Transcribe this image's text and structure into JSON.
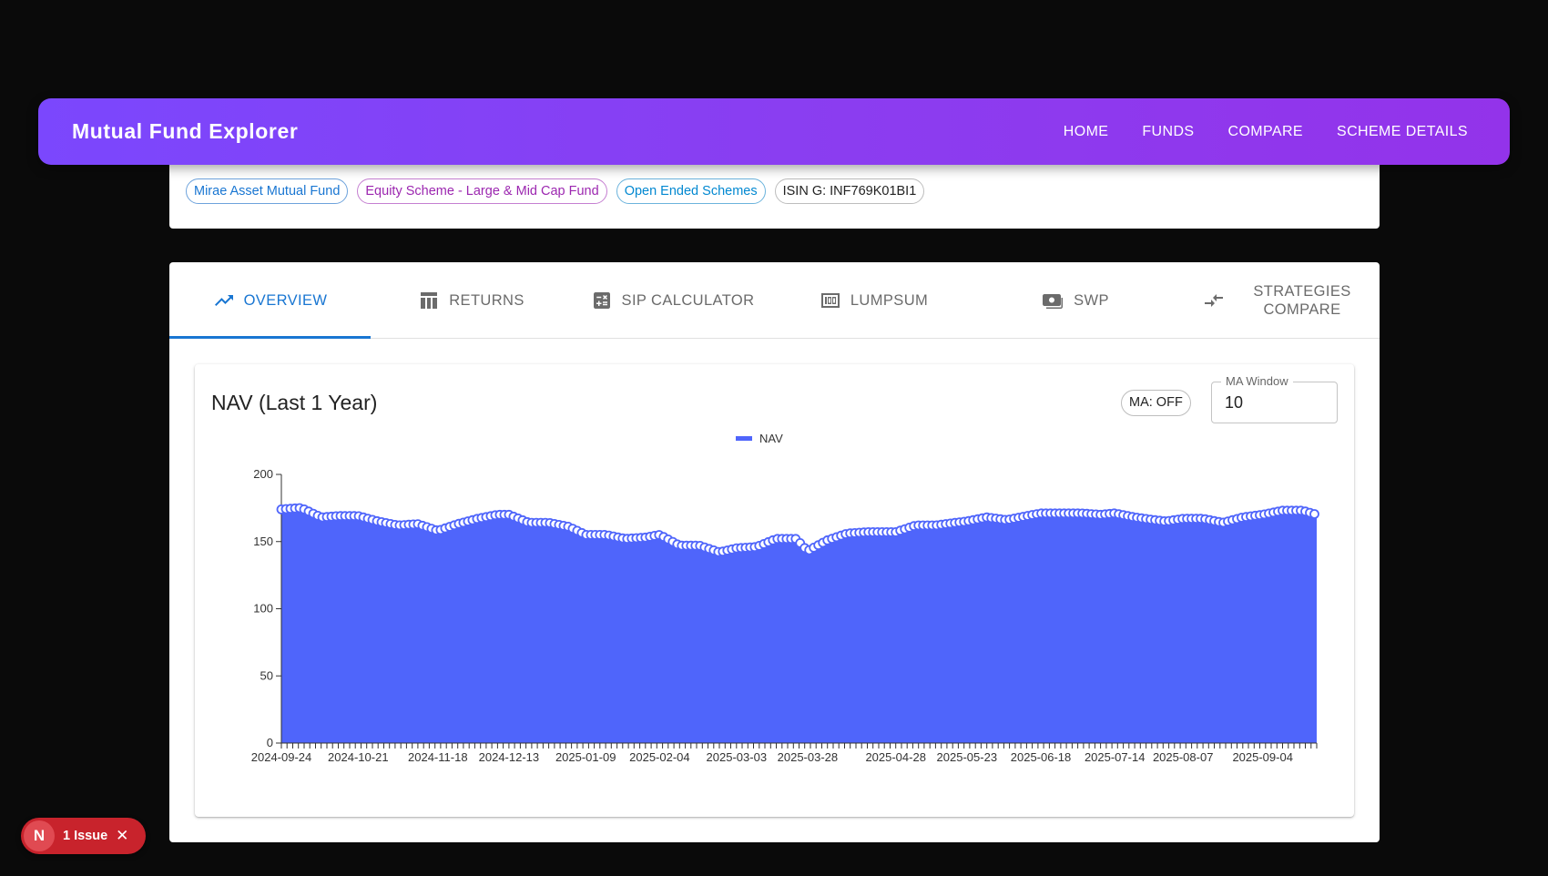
{
  "appbar": {
    "title": "Mutual Fund Explorer",
    "nav": [
      "HOME",
      "FUNDS",
      "COMPARE",
      "SCHEME DETAILS"
    ]
  },
  "chips": [
    {
      "label": "Mirae Asset Mutual Fund",
      "color": "#1976d2"
    },
    {
      "label": "Equity Scheme - Large & Mid Cap Fund",
      "color": "#9c27b0"
    },
    {
      "label": "Open Ended Schemes",
      "color": "#0288d1"
    },
    {
      "label": "ISIN G: INF769K01BI1",
      "color": "#222222"
    }
  ],
  "tabs": [
    {
      "label": "OVERVIEW",
      "icon": "trending-up-icon",
      "active": true
    },
    {
      "label": "RETURNS",
      "icon": "table-icon",
      "active": false
    },
    {
      "label": "SIP CALCULATOR",
      "icon": "calculator-icon",
      "active": false
    },
    {
      "label": "LUMPSUM",
      "icon": "lumpsum-icon",
      "active": false
    },
    {
      "label": "SWP",
      "icon": "payments-icon",
      "active": false
    },
    {
      "label": "STRATEGIES COMPARE",
      "icon": "compare-arrows-icon",
      "active": false
    }
  ],
  "chart_panel": {
    "title": "NAV (Last 1 Year)",
    "ma_toggle": "MA: OFF",
    "ma_window_label": "MA Window",
    "ma_window_value": "10"
  },
  "chart_data": {
    "type": "area",
    "series": [
      {
        "name": "NAV",
        "color": "#4f65fb"
      }
    ],
    "ylim": [
      0,
      200
    ],
    "yticks": [
      0,
      50,
      100,
      150,
      200
    ],
    "x_tick_labels": [
      "2024-09-24",
      "2024-10-21",
      "2024-11-18",
      "2024-12-13",
      "2025-01-09",
      "2025-02-04",
      "2025-03-03",
      "2025-03-28",
      "2025-04-28",
      "2025-05-23",
      "2025-06-18",
      "2025-07-14",
      "2025-08-07",
      "2025-09-04"
    ],
    "nav_points": [
      {
        "date": "2024-09-24",
        "nav": 174
      },
      {
        "date": "2024-10-01",
        "nav": 175
      },
      {
        "date": "2024-10-08",
        "nav": 168
      },
      {
        "date": "2024-10-14",
        "nav": 169
      },
      {
        "date": "2024-10-21",
        "nav": 169
      },
      {
        "date": "2024-10-28",
        "nav": 165
      },
      {
        "date": "2024-11-04",
        "nav": 162
      },
      {
        "date": "2024-11-11",
        "nav": 163
      },
      {
        "date": "2024-11-18",
        "nav": 158
      },
      {
        "date": "2024-11-25",
        "nav": 163
      },
      {
        "date": "2024-12-02",
        "nav": 167
      },
      {
        "date": "2024-12-09",
        "nav": 170
      },
      {
        "date": "2024-12-13",
        "nav": 170
      },
      {
        "date": "2024-12-20",
        "nav": 164
      },
      {
        "date": "2024-12-27",
        "nav": 164
      },
      {
        "date": "2025-01-03",
        "nav": 161
      },
      {
        "date": "2025-01-09",
        "nav": 155
      },
      {
        "date": "2025-01-16",
        "nav": 155
      },
      {
        "date": "2025-01-23",
        "nav": 152
      },
      {
        "date": "2025-01-30",
        "nav": 153
      },
      {
        "date": "2025-02-04",
        "nav": 155
      },
      {
        "date": "2025-02-11",
        "nav": 147
      },
      {
        "date": "2025-02-18",
        "nav": 147
      },
      {
        "date": "2025-02-25",
        "nav": 142
      },
      {
        "date": "2025-03-03",
        "nav": 145
      },
      {
        "date": "2025-03-10",
        "nav": 146
      },
      {
        "date": "2025-03-17",
        "nav": 152
      },
      {
        "date": "2025-03-24",
        "nav": 152
      },
      {
        "date": "2025-03-28",
        "nav": 143
      },
      {
        "date": "2025-04-04",
        "nav": 151
      },
      {
        "date": "2025-04-11",
        "nav": 156
      },
      {
        "date": "2025-04-18",
        "nav": 157
      },
      {
        "date": "2025-04-28",
        "nav": 157
      },
      {
        "date": "2025-05-05",
        "nav": 162
      },
      {
        "date": "2025-05-12",
        "nav": 162
      },
      {
        "date": "2025-05-19",
        "nav": 164
      },
      {
        "date": "2025-05-23",
        "nav": 165
      },
      {
        "date": "2025-05-30",
        "nav": 168
      },
      {
        "date": "2025-06-06",
        "nav": 166
      },
      {
        "date": "2025-06-13",
        "nav": 169
      },
      {
        "date": "2025-06-18",
        "nav": 171
      },
      {
        "date": "2025-06-25",
        "nav": 171
      },
      {
        "date": "2025-07-02",
        "nav": 171
      },
      {
        "date": "2025-07-09",
        "nav": 170
      },
      {
        "date": "2025-07-14",
        "nav": 171
      },
      {
        "date": "2025-07-21",
        "nav": 168
      },
      {
        "date": "2025-07-28",
        "nav": 166
      },
      {
        "date": "2025-08-01",
        "nav": 165
      },
      {
        "date": "2025-08-07",
        "nav": 167
      },
      {
        "date": "2025-08-14",
        "nav": 167
      },
      {
        "date": "2025-08-21",
        "nav": 164
      },
      {
        "date": "2025-08-28",
        "nav": 168
      },
      {
        "date": "2025-09-04",
        "nav": 170
      },
      {
        "date": "2025-09-11",
        "nav": 173
      },
      {
        "date": "2025-09-18",
        "nav": 173
      },
      {
        "date": "2025-09-23",
        "nav": 170
      }
    ]
  },
  "issue_badge": {
    "letter": "N",
    "label": "1 Issue",
    "close": "✕"
  }
}
